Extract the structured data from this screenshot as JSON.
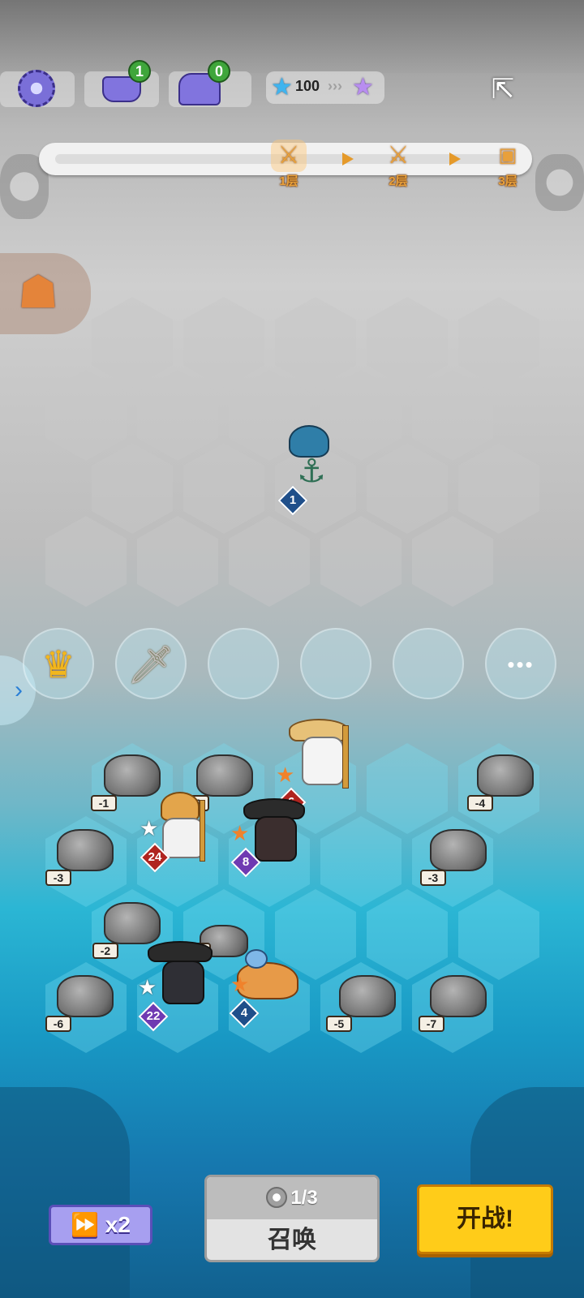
{
  "top_bar": {
    "settings_icon": "gear-icon",
    "anvil_count": "1",
    "chest_count": "0",
    "star_count": "100",
    "share_icon": "share-icon"
  },
  "progress": {
    "stages": [
      {
        "label": "1层",
        "icon": "crossed-swords-icon",
        "current": true
      },
      {
        "label": "2层",
        "icon": "crossed-swords-icon",
        "current": false
      },
      {
        "label": "3层",
        "icon": "treasure-chest-icon",
        "current": false
      }
    ]
  },
  "enemy": {
    "name": "shark-pirate",
    "level": "1"
  },
  "items": [
    {
      "icon": "jeweled-crown-icon"
    },
    {
      "icon": "dagger-icon"
    },
    {
      "icon": ""
    },
    {
      "icon": ""
    },
    {
      "icon": ""
    },
    {
      "icon": "more-icon",
      "label": "•••"
    }
  ],
  "rocks": [
    {
      "hp": "-1"
    },
    {
      "hp": "-3"
    },
    {
      "hp": "-4"
    },
    {
      "hp": "-3"
    },
    {
      "hp": "-3"
    },
    {
      "hp": "-2"
    },
    {
      "hp": "-8"
    },
    {
      "hp": "-6"
    },
    {
      "hp": "-5"
    },
    {
      "hp": "-7"
    }
  ],
  "heroes": [
    {
      "name": "straw-hat-monk",
      "level": "6",
      "star": "★",
      "star_color": "#f0822b",
      "level_color": "#b0241f"
    },
    {
      "name": "blond-priest",
      "level": "24",
      "star": "★",
      "star_color": "#ffffff",
      "level_color": "#b0241f"
    },
    {
      "name": "witch-hat-mage",
      "level": "8",
      "star": "★",
      "star_color": "#f0822b",
      "level_color": "#6f3ab2"
    },
    {
      "name": "masked-gunslinger",
      "level": "22",
      "star": "★",
      "star_color": "#ffffff",
      "level_color": "#6f3ab2"
    },
    {
      "name": "corgi-rider",
      "level": "4",
      "star": "★",
      "star_color": "#f0822b",
      "level_color": "#1f4f8a"
    }
  ],
  "controls": {
    "speed_label": "x2",
    "speed_icon": "fast-forward-icon",
    "summon_count": "1/3",
    "summon_label": "召唤",
    "fight_label": "开战!"
  }
}
